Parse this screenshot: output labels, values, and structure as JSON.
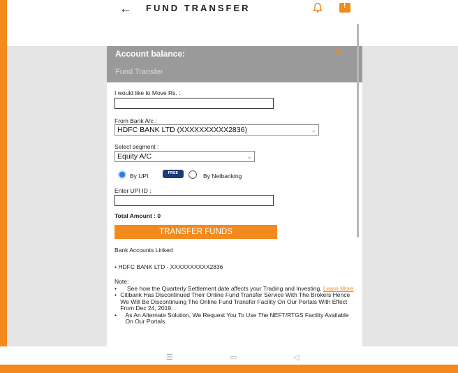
{
  "colors": {
    "accent": "#f28a1d",
    "band": "#9a9a9a",
    "radio_on": "#2f7be0",
    "badge": "#1b3a7a"
  },
  "header": {
    "title": "FUND TRANSFER",
    "back_icon": "back-arrow-icon",
    "bell_icon": "bell-icon",
    "chat_icon": "alert-chat-icon"
  },
  "account": {
    "balance_label": "Account balance:",
    "section_label": "Fund Transfer"
  },
  "form": {
    "amount_label": "I would like to Move Rs. :",
    "amount_value": "",
    "from_bank_label": "From Bank A/c :",
    "from_bank_value": "HDFC BANK LTD (XXXXXXXXXX2836)",
    "segment_label": "Select segment :",
    "segment_value": "Equity A/C",
    "by_upi_label": "By UPI",
    "free_badge": "FREE",
    "by_netbanking_label": "By Netbanking",
    "upi_label": "Enter UPI ID :",
    "upi_value": "",
    "total_label": "Total Amount : 0",
    "transfer_button": "TRANSFER FUNDS"
  },
  "linked": {
    "heading": "Bank Accounts Linked",
    "items": [
      "HDFC BANK LTD - XXXXXXXXXX2836"
    ]
  },
  "notes": {
    "heading": "Note:",
    "item1": "See how the Quarterly Settlement date affects your Trading and Investing.",
    "item1_link": "Learn More",
    "item2": "Citibank Has Discontinued Their Online Fund Transfer Service With The Brokers Hence We Will Be Discontinuing The Online Fund Transfer Facility On Our Portals With Effect From Dec 24, 2019.",
    "item3": "As An Alternate Solution, We Request You To Use The NEFT/RTGS Facility Available On Our Portals."
  },
  "navbar": {
    "menu_icon": "menu-icon",
    "home_icon": "home-icon",
    "back_icon": "back-triangle-icon"
  }
}
